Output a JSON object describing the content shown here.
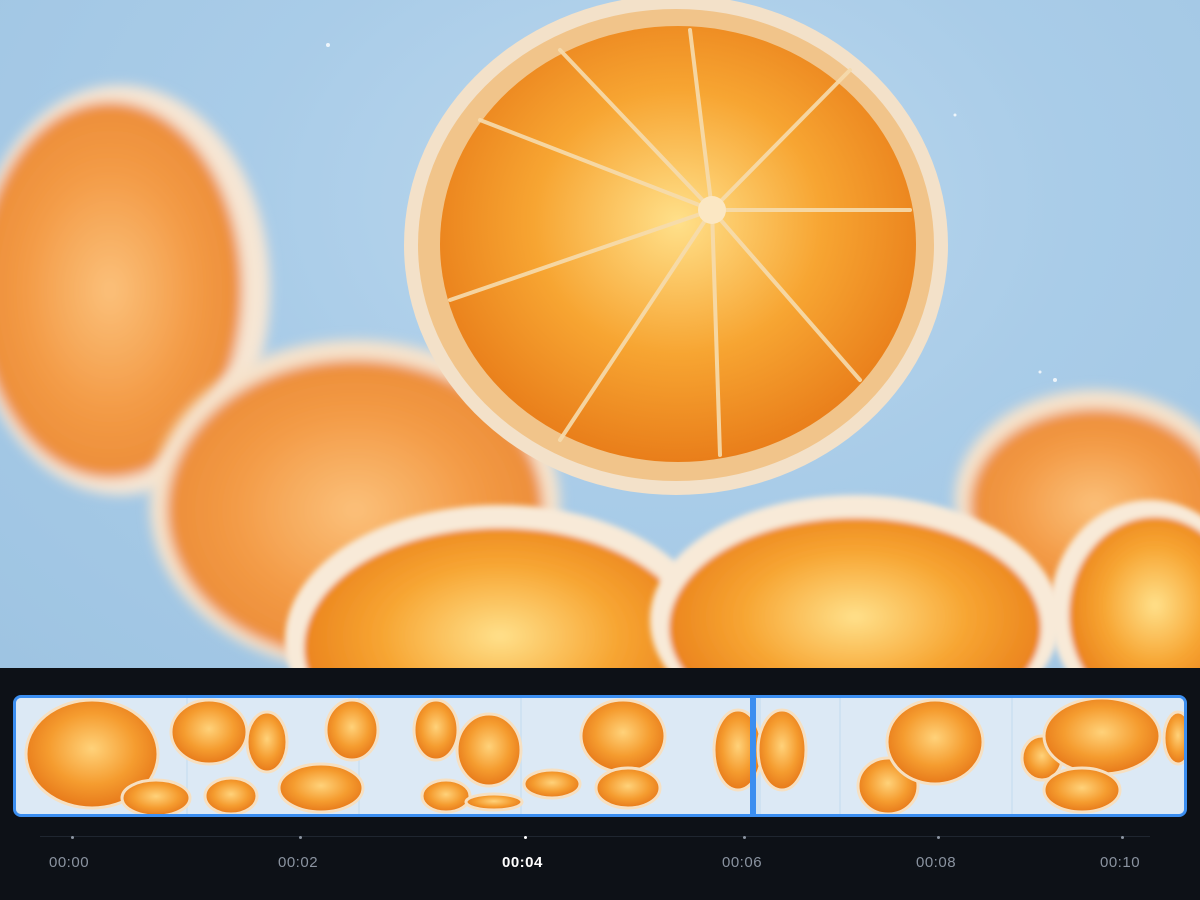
{
  "preview": {
    "subject": "falling-orange-slices-icon"
  },
  "timeline": {
    "current_time": "00:04",
    "markers": [
      {
        "label": "00:00",
        "active": false
      },
      {
        "label": "00:02",
        "active": false
      },
      {
        "label": "00:04",
        "active": true
      },
      {
        "label": "00:06",
        "active": false
      },
      {
        "label": "00:08",
        "active": false
      },
      {
        "label": "00:10",
        "active": false
      }
    ]
  },
  "colors": {
    "accent": "#3b8ef0",
    "panel_bg": "#0d1117",
    "label_inactive": "#8a93a0",
    "label_active": "#ffffff",
    "orange": "#f39a2c",
    "sky": "#a9cce8"
  }
}
